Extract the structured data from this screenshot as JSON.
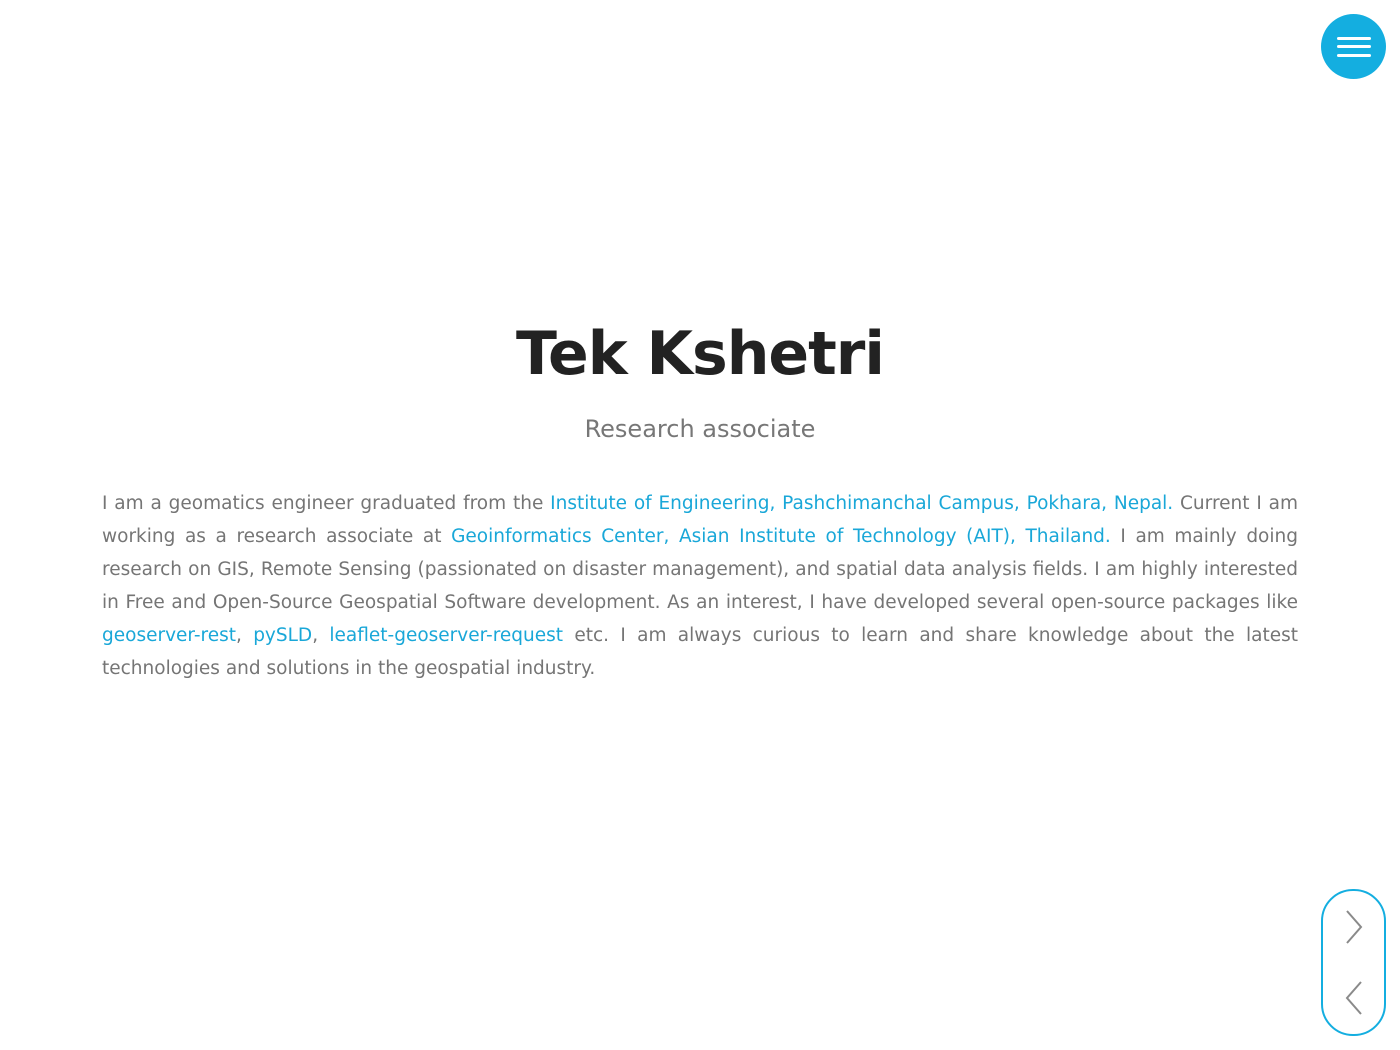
{
  "menu": {
    "icon": "hamburger-icon",
    "accent_color": "#14aee0"
  },
  "hero": {
    "name": "Tek Kshetri",
    "role": "Research associate"
  },
  "bio": {
    "t1": "I am a geomatics engineer graduated from the ",
    "link_institute": "Institute of Engineering, Pashchimanchal Campus, Pokhara, Nepal.",
    "t2": " Current I am working as a research associate at ",
    "link_gic": "Geoinformatics Center, Asian Institute of Technology (AIT), Thailand.",
    "t3": " I am mainly doing research on GIS, Remote Sensing (passionated on disaster management), and spatial data analysis fields. I am highly interested in Free and Open-Source Geospatial Software development. As an interest, I have developed several open-source packages like ",
    "link_geoserver_rest": "geoserver-rest",
    "sep1": ", ",
    "link_pysld": "pySLD",
    "sep2": ", ",
    "link_leaflet": "leaflet-geoserver-request",
    "t4": " etc. I am always curious to learn and share knowledge about the latest technologies and solutions in the geospatial industry.",
    "link_color": "#19a7d8"
  },
  "slide_nav": {
    "next_icon": "chevron-right-icon",
    "prev_icon": "chevron-left-icon"
  }
}
